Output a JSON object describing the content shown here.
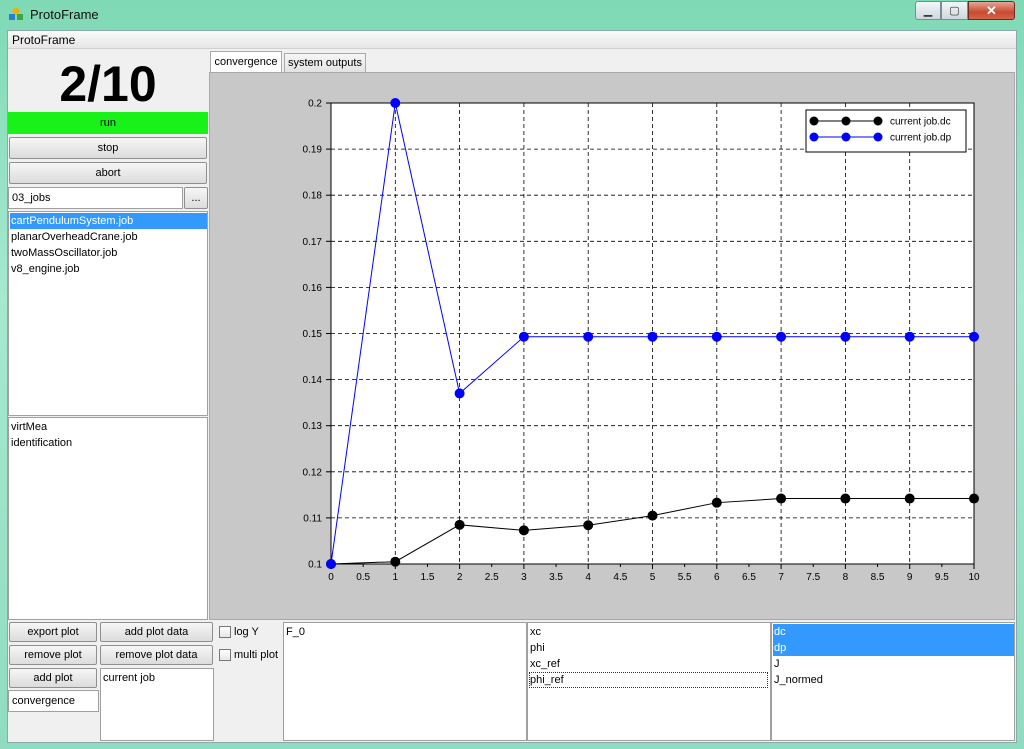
{
  "window": {
    "title": "ProtoFrame"
  },
  "menu": {
    "items": [
      "ProtoFrame"
    ]
  },
  "left": {
    "counter": "2/10",
    "run_label": "run",
    "stop_label": "stop",
    "abort_label": "abort",
    "folder": "03_jobs",
    "browse_label": "...",
    "jobs": [
      "cartPendulumSystem.job",
      "planarOverheadCrane.job",
      "twoMassOscillator.job",
      "v8_engine.job"
    ],
    "modes": [
      "virtMea",
      "identification"
    ]
  },
  "tabs": [
    "convergence",
    "system outputs"
  ],
  "chart_data": {
    "type": "line",
    "x": [
      0,
      1,
      2,
      3,
      4,
      5,
      6,
      7,
      8,
      9,
      10
    ],
    "series": [
      {
        "name": "current job.dc",
        "color": "#000000",
        "values": [
          0.1,
          0.1005,
          0.1085,
          0.1073,
          0.1084,
          0.1105,
          0.1133,
          0.1142,
          0.1142,
          0.1142,
          0.1142
        ]
      },
      {
        "name": "current job.dp",
        "color": "#0000ff",
        "values": [
          0.1,
          0.2,
          0.137,
          0.1493,
          0.1493,
          0.1493,
          0.1493,
          0.1493,
          0.1493,
          0.1493,
          0.1493
        ]
      }
    ],
    "xlim": [
      0,
      10
    ],
    "ylim": [
      0.1,
      0.2
    ],
    "xticks": [
      "0",
      "0.5",
      "1",
      "1.5",
      "2",
      "2.5",
      "3",
      "3.5",
      "4",
      "4.5",
      "5",
      "5.5",
      "6",
      "6.5",
      "7",
      "7.5",
      "8",
      "8.5",
      "9",
      "9.5",
      "10"
    ],
    "yticks": [
      "0.1",
      "0.11",
      "0.12",
      "0.13",
      "0.14",
      "0.15",
      "0.16",
      "0.17",
      "0.18",
      "0.19",
      "0.2"
    ],
    "grid": true,
    "legend": "top-right"
  },
  "bottom": {
    "export_plot": "export plot",
    "add_plot_data": "add plot data",
    "remove_plot": "remove plot",
    "remove_plot_data": "remove plot data",
    "add_plot": "add plot",
    "plot_name": "convergence",
    "sources": [
      "current job"
    ],
    "log_y": "log Y",
    "multi_plot": "multi plot",
    "params": [
      "F_0"
    ],
    "signals": [
      "xc",
      "phi",
      "xc_ref",
      "phi_ref"
    ],
    "metrics": [
      "dc",
      "dp",
      "J",
      "J_normed"
    ]
  }
}
